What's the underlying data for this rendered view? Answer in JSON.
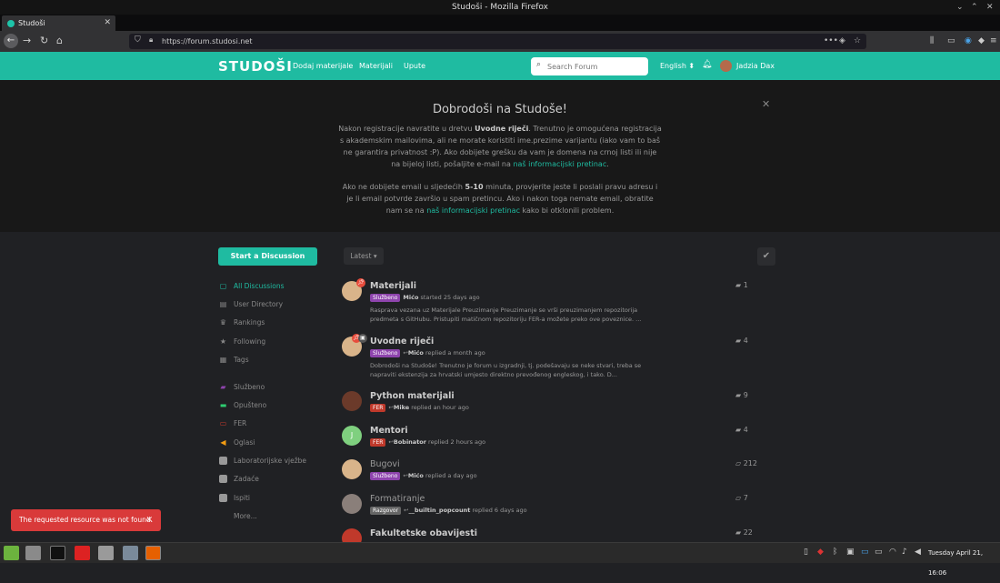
{
  "window": {
    "title": "Studoši - Mozilla Firefox"
  },
  "browser": {
    "tab_title": "Studoši",
    "url": "https://forum.studosi.net"
  },
  "header": {
    "logo": "STUDOŠI",
    "nav": [
      "Dodaj materijale",
      "Materijali",
      "Upute"
    ],
    "search_placeholder": "Search Forum",
    "language": "English ⬍",
    "username": "Jadzia Dax"
  },
  "hero": {
    "title": "Dobrodoši na Studoše!",
    "p1_a": "Nakon registracije navratite u dretvu ",
    "p1_b": "Uvodne riječi",
    "p1_c": ". Trenutno je omogućena registracija s akademskim mailovima, ali ne morate koristiti ime.prezime varijantu (iako vam to baš ne garantira privatnost :P). Ako dobijete grešku da vam je domena na crnoj listi ili nije na bijeloj listi, pošaljite e-mail na ",
    "p1_link": "naš informacijski pretinac",
    "p1_d": ".",
    "p2_a": "Ako ne dobijete email u sljedećih ",
    "p2_b": "5-10",
    "p2_c": " minuta, provjerite jeste li poslali pravu adresu i je li email potvrde završio u spam pretincu. Ako i nakon toga nemate email, obratite nam se na ",
    "p2_link": "naš informacijski pretinac",
    "p2_d": " kako bi otklonili problem."
  },
  "sidebar": {
    "start_button": "Start a Discussion",
    "items": [
      "All Discussions",
      "User Directory",
      "Rankings",
      "Following",
      "Tags",
      "Službeno",
      "Opušteno",
      "FER",
      "Oglasi",
      "Laboratorijske vježbe",
      "Zadaće",
      "Ispiti",
      "More..."
    ]
  },
  "list": {
    "sort_label": "Latest ▾",
    "mark_read": "✔"
  },
  "discussions": [
    {
      "title": "Materijali",
      "tag": "Službeno",
      "tag_color": "#8e44ad",
      "meta_user": "Mićo",
      "meta_text": " started 25 days ago",
      "excerpt": "Rasprava vezana uz Materijale Preuzimanje Preuzimanje se vrši preuzimanjem repozitorija predmeta s GitHubu. Pristupiti matičnom repozitoriju FER-a možete preko ove poveznice. ...",
      "count": "1",
      "avatar_color": "#d9b48a"
    },
    {
      "title": "Uvodne riječi",
      "tag": "Službeno",
      "tag_color": "#8e44ad",
      "meta_user": "Mićo",
      "meta_text": " replied a month ago",
      "excerpt": "Dobrodoši na Studoše! Trenutno je forum u izgradnji, tj. podešavaju se neke stvari, treba se napraviti ekstenzija za hrvatski umjesto direktno prevođenog engleskog, i tako. D...",
      "count": "4",
      "avatar_color": "#d9b48a"
    },
    {
      "title": "Python materijali",
      "tag": "FER",
      "tag_color": "#c0392b",
      "meta_user": "Mike",
      "meta_text": " replied an hour ago",
      "excerpt": "",
      "count": "9",
      "avatar_color": "#6b3a2a"
    },
    {
      "title": "Mentori",
      "tag": "FER",
      "tag_color": "#c0392b",
      "meta_user": "Bobinator",
      "meta_text": " replied 2 hours ago",
      "excerpt": "",
      "count": "4",
      "avatar_color": "#7fd07f",
      "avatar_letter": "J"
    },
    {
      "title": "Bugovi",
      "tag": "Službeno",
      "tag_color": "#8e44ad",
      "meta_user": "Mićo",
      "meta_text": " replied a day ago",
      "excerpt": "",
      "count": "212",
      "avatar_color": "#d9b48a"
    },
    {
      "title": "Formatiranje",
      "tag": "Razgovor",
      "tag_color": "#666666",
      "meta_user": "__builtin_popcount",
      "meta_text": " replied 6 days ago",
      "excerpt": "",
      "count": "7",
      "avatar_color": "#8a7f7a"
    },
    {
      "title": "Fakultetske obavijesti",
      "tag": "",
      "tag_color": "#c0392b",
      "meta_user": "",
      "meta_text": "",
      "excerpt": "",
      "count": "22",
      "avatar_color": "#c0392b"
    }
  ],
  "toast": {
    "message": "The requested resource was not found."
  },
  "taskbar": {
    "clock": "Tuesday April 21, 16:06"
  }
}
